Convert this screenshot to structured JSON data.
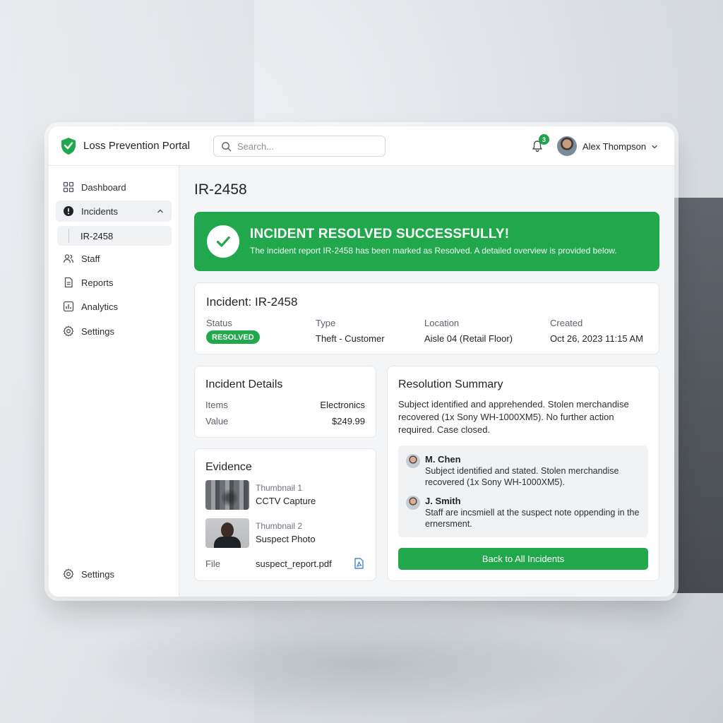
{
  "app": {
    "title": "Loss Prevention Portal",
    "logo_icon": "shield-check-icon"
  },
  "search": {
    "placeholder": "Search..."
  },
  "notifications": {
    "count": "3"
  },
  "user": {
    "name": "Alex Thompson"
  },
  "sidebar": {
    "items": [
      {
        "label": "Dashboard",
        "icon": "grid-icon"
      },
      {
        "label": "Incidents",
        "icon": "alert-circle-icon"
      },
      {
        "label": "Staff",
        "icon": "users-icon"
      },
      {
        "label": "Reports",
        "icon": "document-icon"
      },
      {
        "label": "Analytics",
        "icon": "bar-chart-icon"
      },
      {
        "label": "Settings",
        "icon": "gear-icon"
      }
    ],
    "sub_item": "IR-2458",
    "footer_settings": "Settings"
  },
  "page": {
    "title": "IR-2458"
  },
  "banner": {
    "title": "INCIDENT RESOLVED SUCCESSFULLY!",
    "subtitle": "The incident report IR-2458 has been marked as Resolved. A detailed overview is provided below."
  },
  "summary": {
    "title": "Incident: IR-2458",
    "status_label": "Status",
    "status_value": "RESOLVED",
    "type_label": "Type",
    "type_value": "Theft - Customer",
    "location_label": "Location",
    "location_value": "Aisle 04 (Retail Floor)",
    "created_label": "Created",
    "created_value": "Oct 26, 2023 11:15 AM"
  },
  "details": {
    "title": "Incident Details",
    "items_label": "Items",
    "items_value": "Electronics",
    "value_label": "Value",
    "value_value": "$249.99"
  },
  "evidence": {
    "title": "Evidence",
    "thumb1_label": "Thumbnail 1",
    "thumb1_caption": "CCTV Capture",
    "thumb2_label": "Thumbnail 2",
    "thumb2_caption": "Suspect Photo",
    "file_label": "File",
    "file_name": "suspect_report.pdf"
  },
  "resolution": {
    "title": "Resolution Summary",
    "text": "Subject identified and apprehended. Stolen merchandise recovered (1x Sony WH-1000XM5). No further action required. Case closed.",
    "comments": [
      {
        "name": "M. Chen",
        "text": "Subject identified and stated. Stolen merchandise recovered (1x Sony WH-1000XM5)."
      },
      {
        "name": "J. Smith",
        "text": "Staff are incsmiell at the suspect note oppending in the ernersment."
      }
    ],
    "back_button": "Back to All Incidents"
  },
  "colors": {
    "accent": "#22a84c",
    "background": "#f4f5f7"
  }
}
